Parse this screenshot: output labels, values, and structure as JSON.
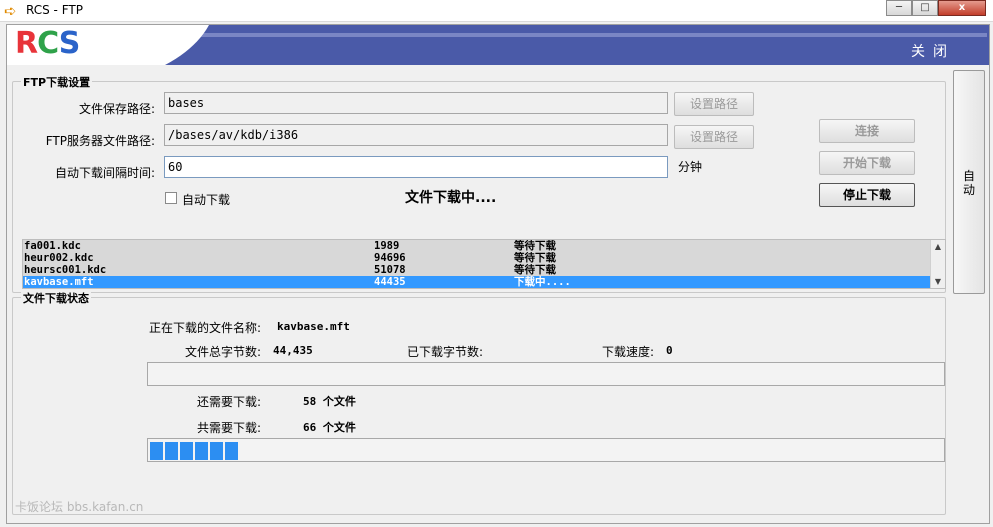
{
  "window": {
    "title": "RCS - FTP",
    "minimize": "─",
    "maximize": "□",
    "close": "x"
  },
  "banner": {
    "logo": [
      "R",
      "C",
      "S"
    ],
    "close_label": "关闭"
  },
  "ftp_settings": {
    "group_title": "FTP下载设置",
    "save_path_label": "文件保存路径:",
    "save_path_value": "bases",
    "server_path_label": "FTP服务器文件路径:",
    "server_path_value": "/bases/av/kdb/i386",
    "interval_label": "自动下载间隔时间:",
    "interval_value": "60",
    "interval_unit": "分钟",
    "set_path_button": "设置路径",
    "auto_download_label": "自动下载",
    "status_text": "文件下载中....",
    "connect_button": "连接",
    "start_button": "开始下载",
    "stop_button": "停止下载"
  },
  "side_button": "自动",
  "file_list": [
    {
      "name": "fa001.kdc",
      "size": "1989",
      "status": "等待下载"
    },
    {
      "name": "heur002.kdc",
      "size": "94696",
      "status": "等待下载"
    },
    {
      "name": "heursc001.kdc",
      "size": "51078",
      "status": "等待下载"
    },
    {
      "name": "kavbase.mft",
      "size": "44435",
      "status": "下载中...."
    }
  ],
  "download_status": {
    "group_title": "文件下载状态",
    "current_file_label": "正在下载的文件名称:",
    "current_file_value": "kavbase.mft",
    "total_bytes_label": "文件总字节数:",
    "total_bytes_value": "44,435",
    "downloaded_bytes_label": "已下载字节数:",
    "downloaded_bytes_value": "",
    "speed_label": "下载速度:",
    "speed_value": "0",
    "remaining_label": "还需要下载:",
    "remaining_value": "58 个文件",
    "total_label": "共需要下载:",
    "total_value": "66 个文件",
    "file_progress": 0,
    "overall_progress": 0.11
  },
  "watermark": "卡饭论坛 bbs.kafan.cn",
  "colors": {
    "banner": "#4a5aa8",
    "selection": "#3399ff",
    "progress": "#2c8ef2"
  }
}
